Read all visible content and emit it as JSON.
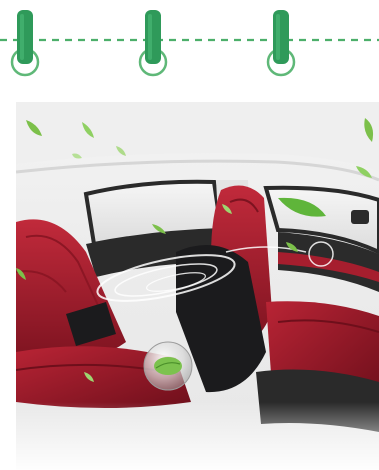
{
  "colors": {
    "ring_green": "#2f9a5a",
    "ring_dark": "#23804a",
    "dash_green": "#4caf6a",
    "seat_red": "#a61e2e",
    "seat_red_dark": "#6e0f1b",
    "seat_black": "#1b1b1d",
    "leaf_green": "#6cc04a",
    "background": "#ffffff"
  },
  "illustration": {
    "subject": "car-interior-air-purification",
    "icons": [
      "binder-ring-icon",
      "leaf-icon",
      "air-swirl-icon",
      "purifier-bubble-icon"
    ]
  }
}
